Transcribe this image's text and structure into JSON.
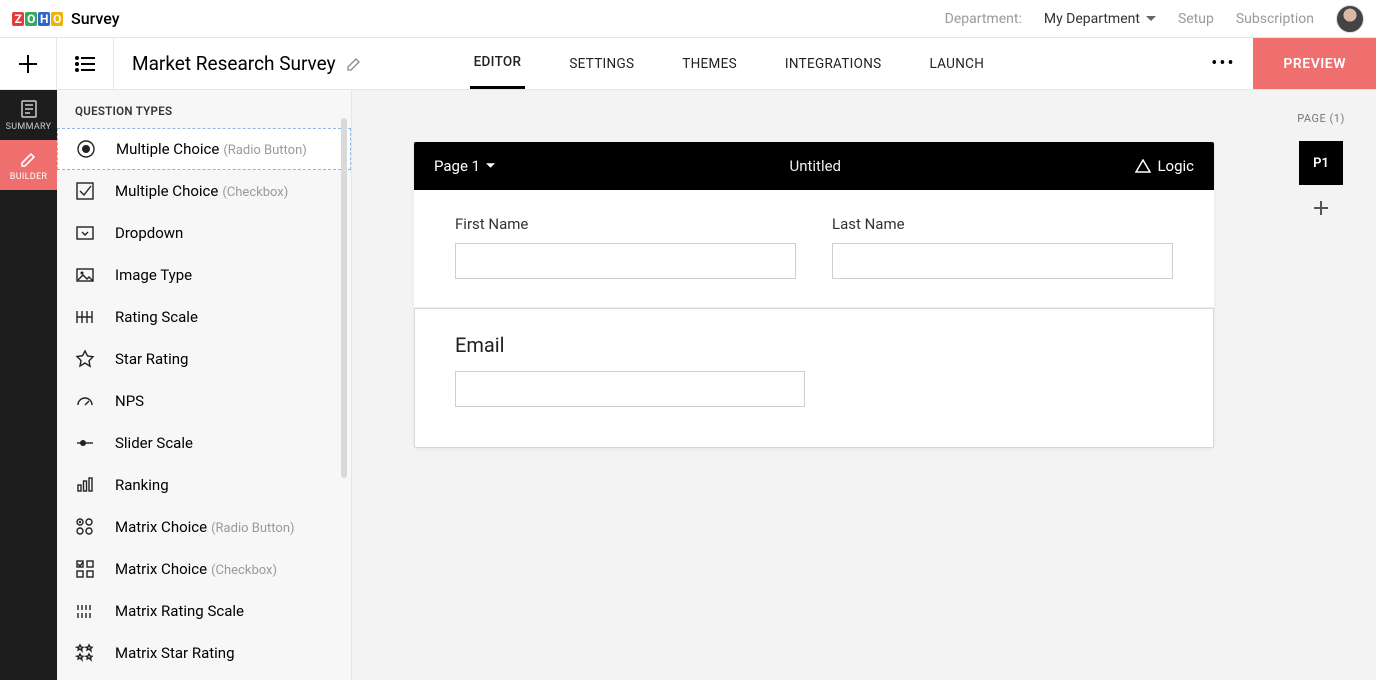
{
  "brand": {
    "suffix": "Survey"
  },
  "header": {
    "department_label": "Department:",
    "department_value": "My Department",
    "setup": "Setup",
    "subscription": "Subscription"
  },
  "toolbar": {
    "survey_title": "Market Research Survey",
    "tabs": [
      "EDITOR",
      "SETTINGS",
      "THEMES",
      "INTEGRATIONS",
      "LAUNCH"
    ],
    "preview": "PREVIEW"
  },
  "rail": {
    "summary": "SUMMARY",
    "builder": "BUILDER"
  },
  "qtypes": {
    "caption": "QUESTION TYPES",
    "items": [
      {
        "label": "Multiple Choice",
        "sub": "(Radio Button)",
        "icon": "radio"
      },
      {
        "label": "Multiple Choice",
        "sub": "(Checkbox)",
        "icon": "checkbox"
      },
      {
        "label": "Dropdown",
        "sub": "",
        "icon": "dropdown"
      },
      {
        "label": "Image Type",
        "sub": "",
        "icon": "image"
      },
      {
        "label": "Rating Scale",
        "sub": "",
        "icon": "rating"
      },
      {
        "label": "Star Rating",
        "sub": "",
        "icon": "star"
      },
      {
        "label": "NPS",
        "sub": "",
        "icon": "gauge"
      },
      {
        "label": "Slider Scale",
        "sub": "",
        "icon": "slider"
      },
      {
        "label": "Ranking",
        "sub": "",
        "icon": "ranking"
      },
      {
        "label": "Matrix Choice",
        "sub": "(Radio Button)",
        "icon": "matrixradio"
      },
      {
        "label": "Matrix Choice",
        "sub": "(Checkbox)",
        "icon": "matrixcheck"
      },
      {
        "label": "Matrix Rating Scale",
        "sub": "",
        "icon": "matrixrating"
      },
      {
        "label": "Matrix Star Rating",
        "sub": "",
        "icon": "matrixstar"
      }
    ]
  },
  "page": {
    "page_label": "Page 1",
    "untitled": "Untitled",
    "logic": "Logic",
    "first_name": "First Name",
    "last_name": "Last Name",
    "email": "Email"
  },
  "pagenav": {
    "caption": "PAGE (1)",
    "chip": "P1"
  }
}
